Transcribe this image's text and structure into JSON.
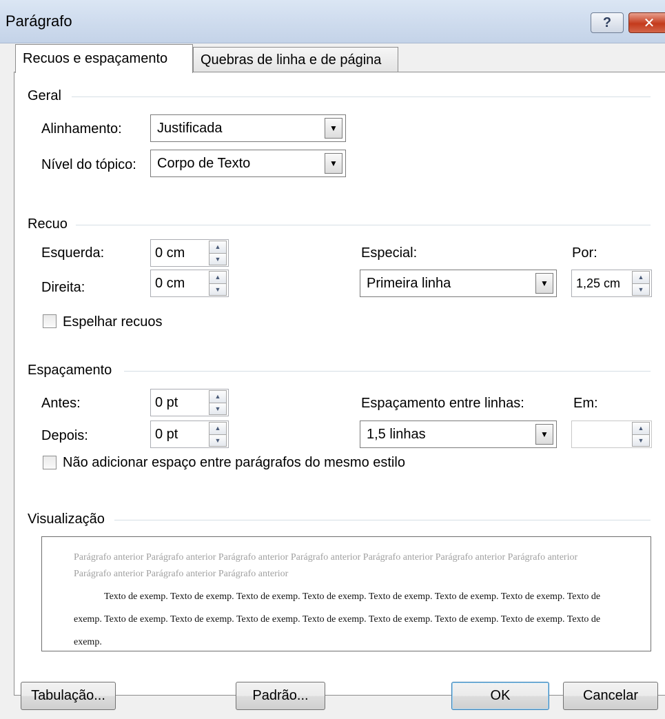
{
  "window": {
    "title": "Parágrafo",
    "help_label": "?",
    "close_label": "✕"
  },
  "tabs": [
    {
      "label": "Recuos e espaçamento",
      "active": true
    },
    {
      "label": "Quebras de linha e de página",
      "active": false
    }
  ],
  "geral": {
    "section_label": "Geral",
    "alinhamento_label": "Alinhamento:",
    "alinhamento_value": "Justificada",
    "nivel_label": "Nível do tópico:",
    "nivel_value": "Corpo de Texto"
  },
  "recuo": {
    "section_label": "Recuo",
    "esquerda_label": "Esquerda:",
    "esquerda_value": "0 cm",
    "direita_label": "Direita:",
    "direita_value": "0 cm",
    "especial_label": "Especial:",
    "especial_value": "Primeira linha",
    "por_label": "Por:",
    "por_value": "1,25 cm",
    "espelhar_label": "Espelhar recuos",
    "espelhar_checked": false
  },
  "espacamento": {
    "section_label": "Espaçamento",
    "antes_label": "Antes:",
    "antes_value": "0 pt",
    "depois_label": "Depois:",
    "depois_value": "0 pt",
    "entre_linhas_label": "Espaçamento entre linhas:",
    "entre_linhas_value": "1,5 linhas",
    "em_label": "Em:",
    "em_value": "",
    "nao_adicionar_label": "Não adicionar espaço entre parágrafos do mesmo estilo",
    "nao_adicionar_checked": false
  },
  "visualizacao": {
    "section_label": "Visualização",
    "previous_text": "Parágrafo anterior Parágrafo anterior Parágrafo anterior Parágrafo anterior Parágrafo anterior Parágrafo anterior Parágrafo anterior Parágrafo anterior Parágrafo anterior Parágrafo anterior",
    "sample_text": "Texto de exemp. Texto de exemp. Texto de exemp. Texto de exemp. Texto de exemp. Texto de exemp. Texto de exemp. Texto de exemp. Texto de exemp. Texto de exemp. Texto de exemp. Texto de exemp. Texto de exemp. Texto de exemp. Texto de exemp. Texto de exemp."
  },
  "buttons": {
    "tabulacao": "Tabulação...",
    "padrao": "Padrão...",
    "ok": "OK",
    "cancelar": "Cancelar"
  }
}
